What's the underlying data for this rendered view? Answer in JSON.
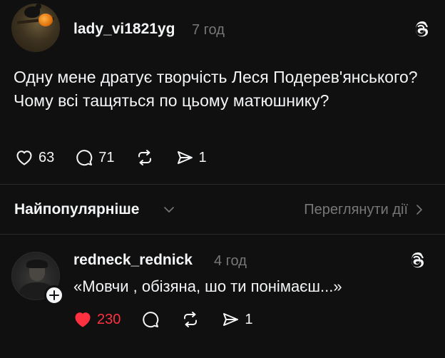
{
  "post": {
    "username": "lady_vi1821yg",
    "time": "7 год",
    "text": "Одну мене дратує творчість Леся Подерев'янського? Чому всі тащяться по цьому матюшнику?",
    "likes": "63",
    "comments": "71",
    "shares": "1"
  },
  "sort_bar": {
    "label": "Найпопулярніше",
    "view_activity": "Переглянути дії"
  },
  "reply": {
    "username": "redneck_rednick",
    "time": "4 год",
    "text": "«Мовчи , обізяна, шо ти понімаєш...»",
    "likes": "230",
    "shares": "1",
    "liked": true
  },
  "icons": {
    "like": "heart-icon",
    "liked": "heart-filled-icon",
    "comment": "comment-bubble-icon",
    "repost": "repost-icon",
    "share": "send-icon",
    "threads": "threads-logo-icon",
    "chevron_down": "chevron-down-icon",
    "chevron_right": "chevron-right-icon",
    "follow": "plus-icon"
  },
  "colors": {
    "background": "#101010",
    "text": "#f3f5f7",
    "muted": "#777777",
    "liked": "#ff3040",
    "divider": "#2a2a2a"
  }
}
